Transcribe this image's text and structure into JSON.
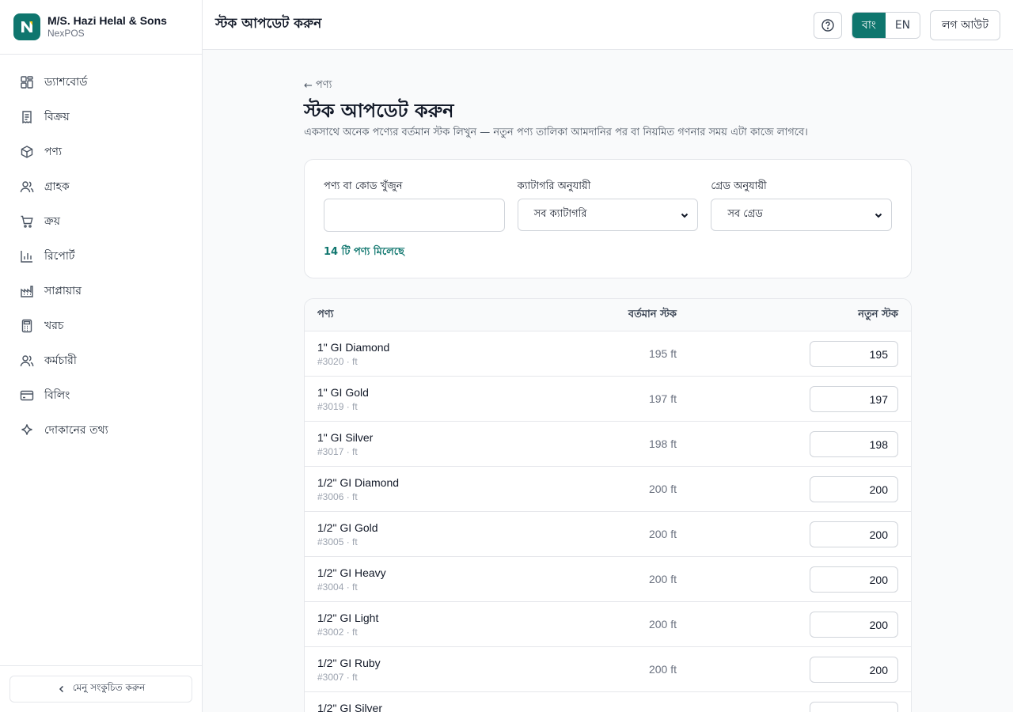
{
  "brand": {
    "shop_name": "M/S. Hazi Helal & Sons",
    "app_name": "NexPOS",
    "accent": "#0f766e"
  },
  "sidebar": {
    "items": [
      {
        "label": "ড্যাশবোর্ড",
        "icon": "dashboard-icon"
      },
      {
        "label": "বিক্রয়",
        "icon": "receipt-icon"
      },
      {
        "label": "পণ্য",
        "icon": "box-icon"
      },
      {
        "label": "গ্রাহক",
        "icon": "users-icon"
      },
      {
        "label": "ক্রয়",
        "icon": "cart-icon"
      },
      {
        "label": "রিপোর্ট",
        "icon": "bar-chart-icon"
      },
      {
        "label": "সাপ্লায়ার",
        "icon": "factory-icon"
      },
      {
        "label": "খরচ",
        "icon": "calculator-icon"
      },
      {
        "label": "কর্মচারী",
        "icon": "users-icon"
      },
      {
        "label": "বিলিং",
        "icon": "credit-card-icon"
      },
      {
        "label": "দোকানের তথ্য",
        "icon": "sparkle-icon"
      }
    ],
    "collapse_label": "মেনু সংকুচিত করুন"
  },
  "header": {
    "title": "স্টক আপডেট করুন",
    "lang_bn": "বাং",
    "lang_en": "EN",
    "logout_label": "লগ আউট"
  },
  "main": {
    "back_label": "পণ্য",
    "title": "স্টক আপডেট করুন",
    "description": "একসাথে অনেক পণ্যের বর্তমান স্টক লিখুন — নতুন পণ্য তালিকা আমদানির পর বা নিয়মিত গণনার সময় এটা কাজে লাগবে।"
  },
  "filters": {
    "search_label": "পণ্য বা কোড খুঁজুন",
    "search_value": "",
    "category_label": "ক্যাটাগরি অনুযায়ী",
    "category_value": "সব ক্যাটাগরি",
    "grade_label": "গ্রেড অনুযায়ী",
    "grade_value": "সব গ্রেড",
    "result_count": "14 টি পণ্য মিলেছে"
  },
  "table": {
    "col_product": "পণ্য",
    "col_current": "বর্তমান স্টক",
    "col_new": "নতুন স্টক",
    "rows": [
      {
        "name": "1\" GI Diamond",
        "meta": "#3020 · ft",
        "current": "195 ft",
        "new": "195"
      },
      {
        "name": "1\" GI Gold",
        "meta": "#3019 · ft",
        "current": "197 ft",
        "new": "197"
      },
      {
        "name": "1\" GI Silver",
        "meta": "#3017 · ft",
        "current": "198 ft",
        "new": "198"
      },
      {
        "name": "1/2\" GI Diamond",
        "meta": "#3006 · ft",
        "current": "200 ft",
        "new": "200"
      },
      {
        "name": "1/2\" GI Gold",
        "meta": "#3005 · ft",
        "current": "200 ft",
        "new": "200"
      },
      {
        "name": "1/2\" GI Heavy",
        "meta": "#3004 · ft",
        "current": "200 ft",
        "new": "200"
      },
      {
        "name": "1/2\" GI Light",
        "meta": "#3002 · ft",
        "current": "200 ft",
        "new": "200"
      },
      {
        "name": "1/2\" GI Ruby",
        "meta": "#3007 · ft",
        "current": "200 ft",
        "new": "200"
      },
      {
        "name": "1/2\" GI Silver",
        "meta": "",
        "current": "",
        "new": ""
      }
    ]
  }
}
